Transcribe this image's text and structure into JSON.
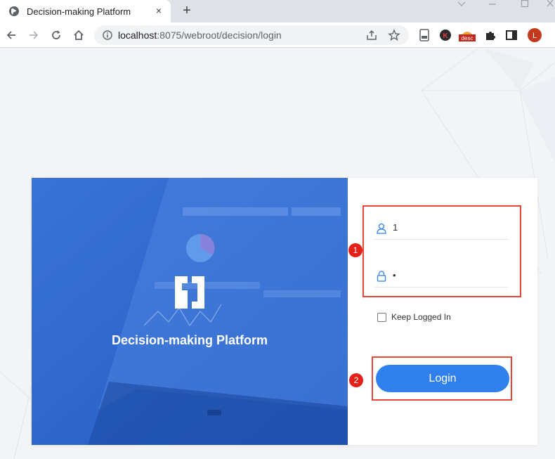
{
  "browser": {
    "tab_title": "Decision-making Platform",
    "tab_close": "×",
    "new_tab": "+",
    "url_host": "localhost",
    "url_path": ":8075/webroot/decision/login",
    "extension_desc_label": "desc",
    "profile_initial": "L",
    "extension_k_label": "K"
  },
  "hero": {
    "title": "Decision-making Platform"
  },
  "form": {
    "username_value": "1",
    "password_value": "•",
    "keep_logged_in_label": "Keep Logged In",
    "login_label": "Login"
  },
  "annotations": {
    "badge_1": "1",
    "badge_2": "2"
  },
  "colors": {
    "accent": "#2f80ed",
    "hero_bg": "#2d67d0",
    "annotation_red": "#e8453c"
  }
}
